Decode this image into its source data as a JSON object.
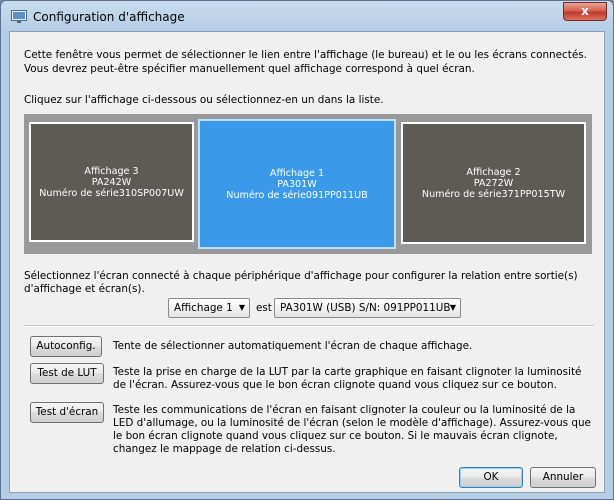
{
  "window": {
    "title": "Configuration d'affichage",
    "close_glyph": "x"
  },
  "intro": {
    "text": "Cette fenêtre vous permet de sélectionner le lien entre l'affichage (le bureau) et le ou les écrans connectés. Vous devrez peut-être spécifier manuellement quel affichage correspond à quel écran.",
    "instruction": "Cliquez sur l'affichage ci-dessous ou sélectionnez-en un dans la liste."
  },
  "displays": [
    {
      "name": "Affichage 3",
      "model": "PA242W",
      "serial": "Numéro de série310SP007UW",
      "selected": false
    },
    {
      "name": "Affichage 1",
      "model": "PA301W",
      "serial": "Numéro de série091PP011UB",
      "selected": true
    },
    {
      "name": "Affichage 2",
      "model": "PA272W",
      "serial": "Numéro de série371PP015TW",
      "selected": false
    }
  ],
  "mapping": {
    "text": "Sélectionnez l'écran connecté à chaque périphérique d'affichage pour configurer la relation entre sortie(s) d'affichage et écran(s).",
    "display_select": "Affichage 1",
    "est_label": "est",
    "monitor_select": "PA301W (USB) S/N: 091PP011UB"
  },
  "actions": {
    "autoconfig_label": "Autoconfig.",
    "autoconfig_desc": "Tente de sélectionner automatiquement l'écran de chaque affichage.",
    "lut_label": "Test de LUT",
    "lut_desc": "Teste la prise en charge de la LUT par la carte graphique en faisant clignoter la luminosité de l'écran. Assurez-vous que le bon écran clignote quand vous cliquez sur ce bouton.",
    "screen_label": "Test d'écran",
    "screen_desc": "Teste les communications de l'écran en faisant clignoter la couleur ou la luminosité de la LED d'allumage, ou la luminosité de l'écran (selon le modèle d'affichage). Assurez-vous que le bon écran clignote quand vous cliquez sur ce bouton. Si le mauvais écran clignote, changez le mappage de relation ci-dessus."
  },
  "footer": {
    "ok_label": "OK",
    "cancel_label": "Annuler"
  },
  "colors": {
    "selected_display": "#3a99e8",
    "unselected_display": "#5e5b57",
    "display_area": "#999999"
  }
}
